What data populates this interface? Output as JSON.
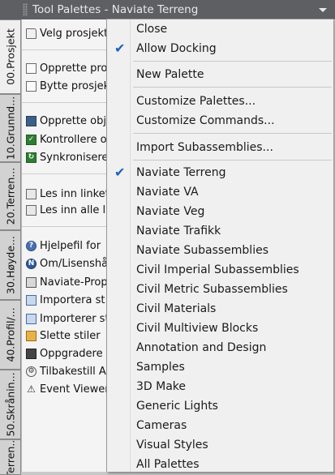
{
  "window": {
    "title": "Tool Palettes - Naviate Terreng"
  },
  "tabs": [
    {
      "label": "00.Prosjekt"
    },
    {
      "label": "10.Grunnd..."
    },
    {
      "label": "20.Terren..."
    },
    {
      "label": "30.Høyde..."
    },
    {
      "label": "40.Profil/..."
    },
    {
      "label": "50.Skrånin..."
    },
    {
      "label": "Terren..."
    }
  ],
  "tools": [
    {
      "label": "Velg prosjekt",
      "icon": "folder-icon"
    },
    {
      "label": "Opprette prosjekt",
      "icon": "new-document-icon"
    },
    {
      "label": "Bytte prosjekt",
      "icon": "switch-document-icon"
    },
    {
      "label": "Opprette objekter",
      "icon": "create-object-icon"
    },
    {
      "label": "Kontrollere objekter",
      "icon": "check-object-icon"
    },
    {
      "label": "Synkronisere objekter",
      "icon": "sync-icon"
    },
    {
      "label": "Les inn linket",
      "icon": "clipboard-icon"
    },
    {
      "label": "Les inn alle l",
      "icon": "clipboard-icon"
    },
    {
      "label": "Hjelpefil for",
      "icon": "help-icon"
    },
    {
      "label": "Om/Lisenshå",
      "icon": "naviate-icon"
    },
    {
      "label": "Naviate-Prop",
      "icon": "properties-icon"
    },
    {
      "label": "Importera st",
      "icon": "import-icon"
    },
    {
      "label": "Importerer st",
      "icon": "import-icon"
    },
    {
      "label": "Slette stiler",
      "icon": "delete-styles-icon"
    },
    {
      "label": "Oppgradere",
      "icon": "upgrade-icon"
    },
    {
      "label": "Tilbakestill A",
      "icon": "gear-icon"
    },
    {
      "label": "Event Viewer",
      "icon": "warning-icon"
    }
  ],
  "menu": {
    "items": [
      {
        "label": "Close",
        "checked": false
      },
      {
        "label": "Allow Docking",
        "checked": true
      },
      {
        "label": "New Palette",
        "checked": false
      },
      {
        "label": "Customize Palettes...",
        "checked": false
      },
      {
        "label": "Customize Commands...",
        "checked": false
      },
      {
        "label": "Import Subassemblies...",
        "checked": false
      },
      {
        "label": "Naviate Terreng",
        "checked": true
      },
      {
        "label": "Naviate VA",
        "checked": false
      },
      {
        "label": "Naviate Veg",
        "checked": false
      },
      {
        "label": "Naviate Trafikk",
        "checked": false
      },
      {
        "label": "Naviate Subassemblies",
        "checked": false
      },
      {
        "label": "Civil Imperial Subassemblies",
        "checked": false
      },
      {
        "label": "Civil Metric Subassemblies",
        "checked": false
      },
      {
        "label": "Civil Materials",
        "checked": false
      },
      {
        "label": "Civil Multiview Blocks",
        "checked": false
      },
      {
        "label": "Annotation and Design",
        "checked": false
      },
      {
        "label": "Samples",
        "checked": false
      },
      {
        "label": "3D Make",
        "checked": false
      },
      {
        "label": "Generic Lights",
        "checked": false
      },
      {
        "label": "Cameras",
        "checked": false
      },
      {
        "label": "Visual Styles",
        "checked": false
      },
      {
        "label": "All Palettes",
        "checked": false
      }
    ]
  },
  "colors": {
    "titlebar": "#5d5f63",
    "menu_background": "#f0f0f0",
    "checkmark": "#1f5fbf"
  }
}
